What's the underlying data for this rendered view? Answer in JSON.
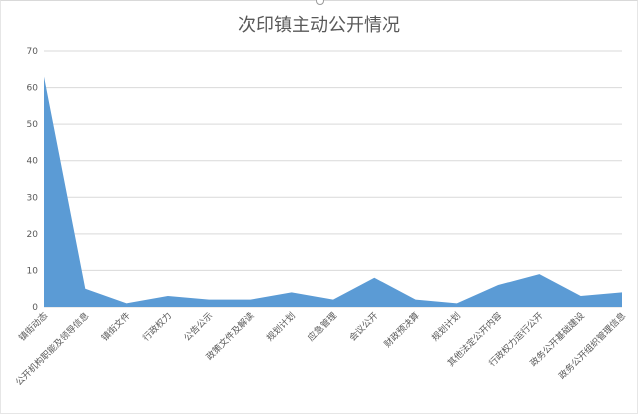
{
  "chart_data": {
    "type": "area",
    "title": "次印镇主动公开情况",
    "xlabel": "",
    "ylabel": "",
    "ylim": [
      0,
      70
    ],
    "yticks": [
      0,
      10,
      20,
      30,
      40,
      50,
      60,
      70
    ],
    "grid": true,
    "legend": "none",
    "categories": [
      "镇街动态",
      "公开机构职能及领导信息",
      "镇街文件",
      "行政权力",
      "公告公示",
      "政策文件及解读",
      "规划计划",
      "应急管理",
      "会议公开",
      "财政预决算",
      "规划计划",
      "其他法定公开内容",
      "行政权力运行公开",
      "政务公开基础建设",
      "政务公开组织管理信息"
    ],
    "values": [
      63,
      5,
      1,
      3,
      2,
      2,
      4,
      2,
      8,
      2,
      1,
      6,
      9,
      3,
      4
    ],
    "colors": {
      "area": "#5b9bd5",
      "grid": "#d9d9d9",
      "text": "#595959",
      "title": "#595959"
    }
  }
}
